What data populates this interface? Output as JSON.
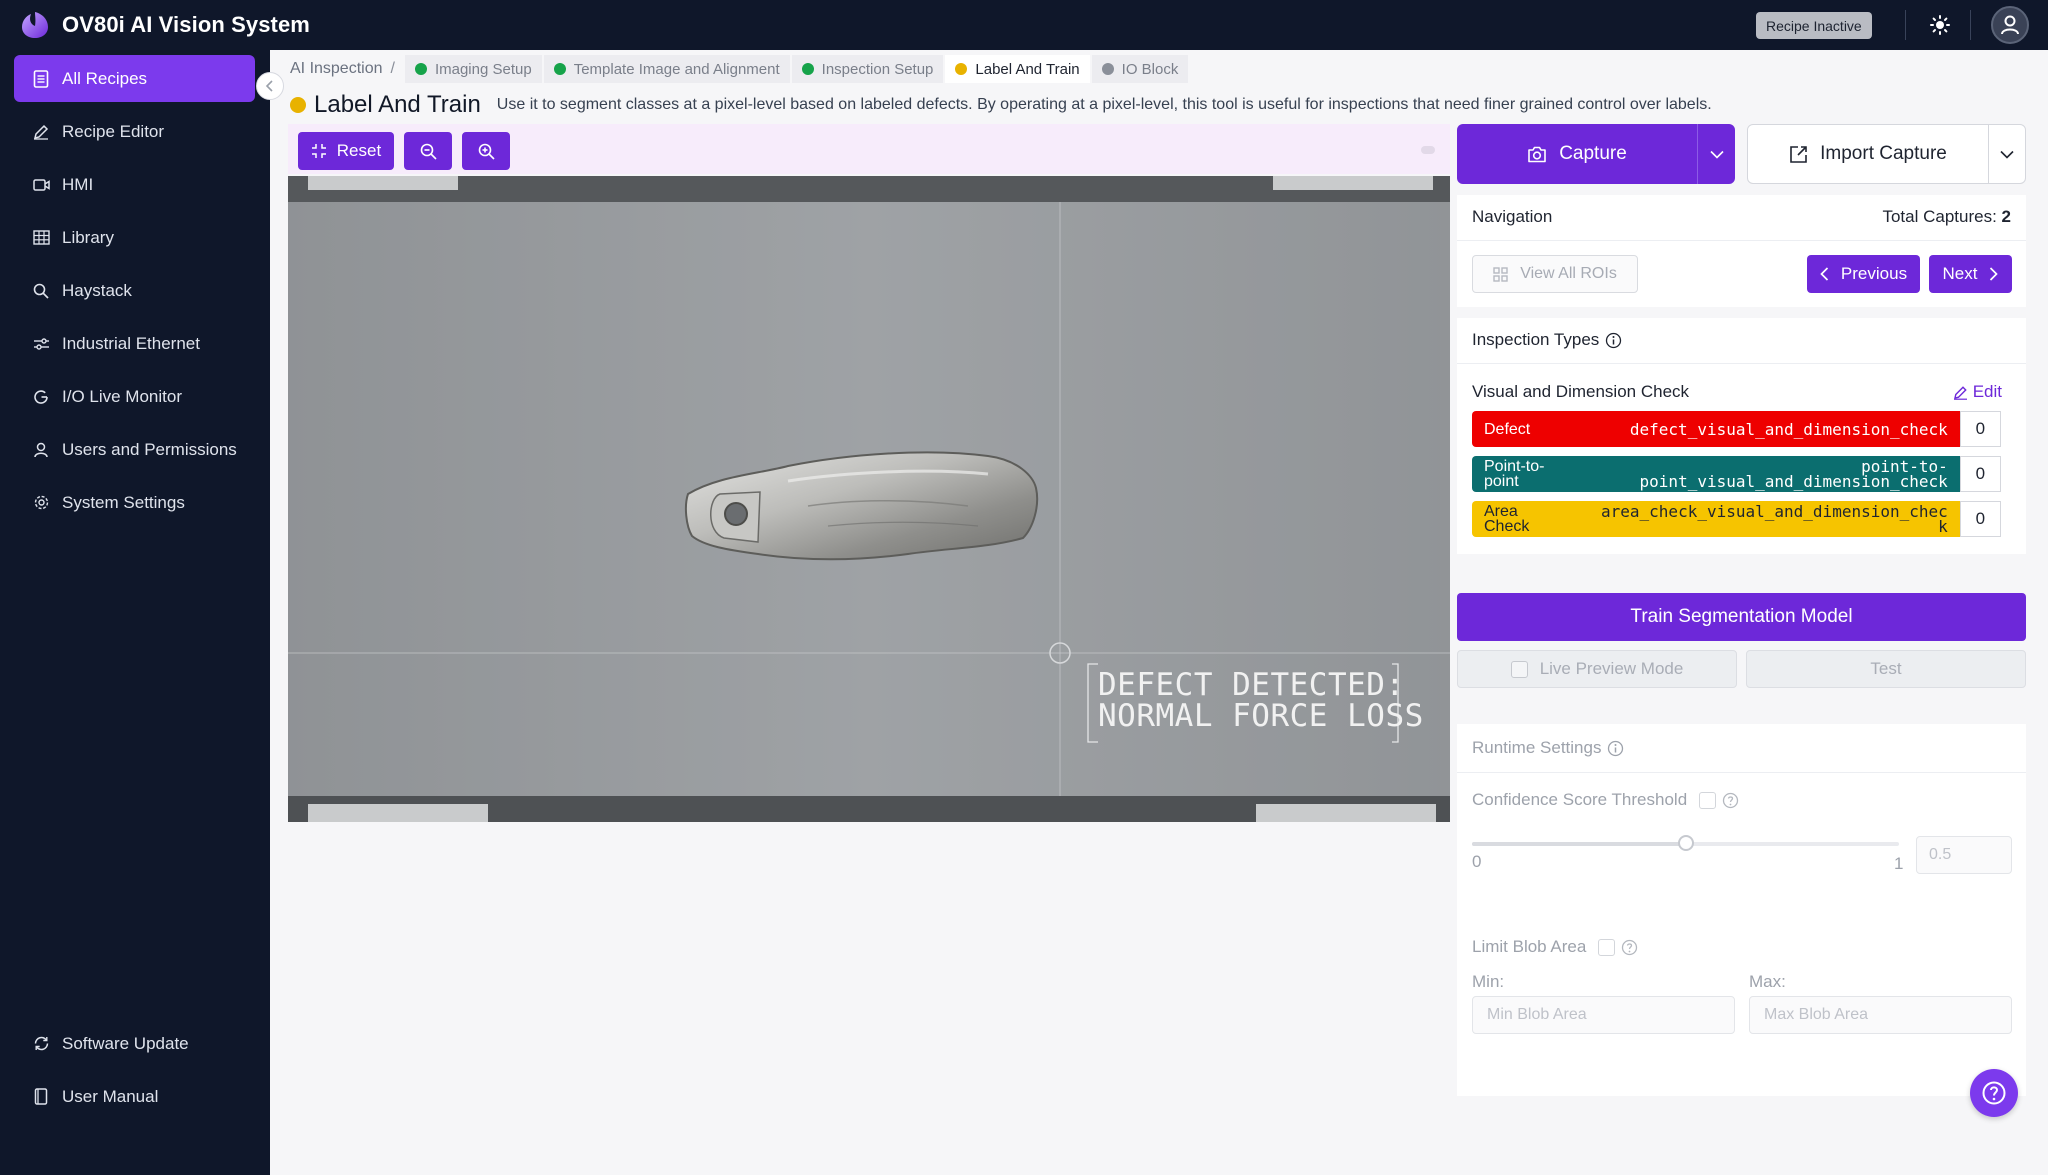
{
  "app": {
    "title": "OV80i AI Vision System",
    "recipe_status": "Recipe Inactive"
  },
  "sidebar": {
    "items": [
      {
        "label": "All Recipes",
        "icon": "document-list-icon",
        "active": true
      },
      {
        "label": "Recipe Editor",
        "icon": "pencil-icon"
      },
      {
        "label": "HMI",
        "icon": "video-icon"
      },
      {
        "label": "Library",
        "icon": "table-grid-icon"
      },
      {
        "label": "Haystack",
        "icon": "search-icon"
      },
      {
        "label": "Industrial Ethernet",
        "icon": "network-icon"
      },
      {
        "label": "I/O Live Monitor",
        "icon": "monitor-g-icon"
      },
      {
        "label": "Users and Permissions",
        "icon": "user-icon"
      },
      {
        "label": "System Settings",
        "icon": "gear-icon"
      }
    ],
    "bottom": [
      {
        "label": "Software Update",
        "icon": "refresh-icon"
      },
      {
        "label": "User Manual",
        "icon": "book-icon"
      }
    ]
  },
  "breadcrumb": {
    "root": "AI Inspection",
    "separator": "/",
    "steps": [
      {
        "label": "Imaging Setup",
        "color": "#16a34a"
      },
      {
        "label": "Template Image and Alignment",
        "color": "#16a34a"
      },
      {
        "label": "Inspection Setup",
        "color": "#16a34a"
      },
      {
        "label": "Label And Train",
        "color": "#e8b200",
        "current": true
      },
      {
        "label": "IO Block",
        "color": "#8a8f99"
      }
    ]
  },
  "page": {
    "title": "Label And Train",
    "description": "Use it to segment classes at a pixel-level based on labeled defects. By operating at a pixel-level, this tool is useful for inspections that need finer grained control over labels."
  },
  "toolbar": {
    "reset_label": "Reset"
  },
  "viewer": {
    "overlay_line1": "DEFECT DETECTED:",
    "overlay_line2": "NORMAL FORCE LOSS"
  },
  "capture": {
    "capture_label": "Capture",
    "import_label": "Import Capture"
  },
  "navigation": {
    "label": "Navigation",
    "total_label": "Total Captures:",
    "total_value": "2",
    "view_rois": "View All ROIs",
    "previous": "Previous",
    "next": "Next"
  },
  "inspection_types": {
    "title": "Inspection Types",
    "group": "Visual and Dimension Check",
    "edit_label": "Edit",
    "classes": [
      {
        "name": "Defect",
        "code": "defect_visual_and_dimension_check",
        "count": "0",
        "color": "#ee0000",
        "text_color": "#ffffff"
      },
      {
        "name_line1": "Point-to-",
        "name_line2": "point",
        "code_line1": "point-to-",
        "code_line2": "point_visual_and_dimension_check",
        "count": "0",
        "color": "#0b6e6f",
        "text_color": "#ffffff"
      },
      {
        "name_line1": "Area",
        "name_line2": "Check",
        "code_line1": "area_check_visual_and_dimension_chec",
        "code_line2": "k",
        "count": "0",
        "color": "#f6c400",
        "text_color": "#1f2430"
      }
    ]
  },
  "train": {
    "train_label": "Train Segmentation Model",
    "live_preview": "Live Preview Mode",
    "test": "Test"
  },
  "runtime": {
    "title": "Runtime Settings",
    "confidence_label": "Confidence Score Threshold",
    "slider_min": "0",
    "slider_max": "1",
    "slider_value": 0.5,
    "threshold_placeholder": "0.5",
    "limit_blob_label": "Limit Blob Area",
    "min_label": "Min:",
    "max_label": "Max:",
    "min_placeholder": "Min Blob Area",
    "max_placeholder": "Max Blob Area"
  },
  "colors": {
    "accent": "#6d28d9",
    "sidebar_bg": "#0f172a"
  }
}
